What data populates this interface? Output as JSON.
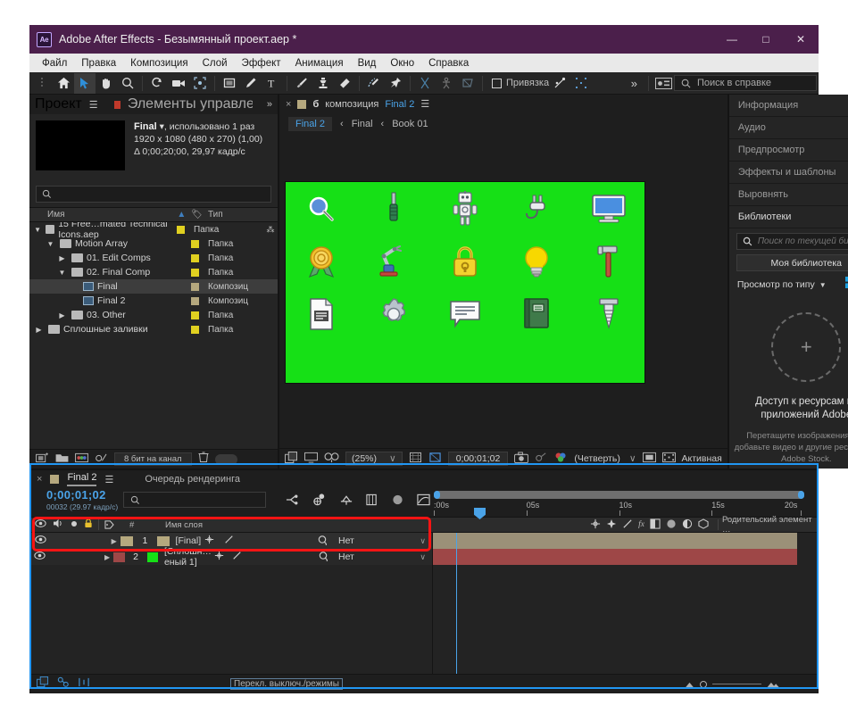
{
  "window": {
    "title": "Adobe After Effects - Безымянный проект.aep *",
    "logo_text": "Ae",
    "minimize": "—",
    "maximize": "□",
    "close": "✕"
  },
  "menu": {
    "items": [
      "Файл",
      "Правка",
      "Композиция",
      "Слой",
      "Эффект",
      "Анимация",
      "Вид",
      "Окно",
      "Справка"
    ]
  },
  "toolbar": {
    "snap_label": "Привязка",
    "overflow": "»",
    "help_placeholder": "Поиск в справке"
  },
  "project_panel": {
    "tab_active": "Проект",
    "tab_secondary": "Элементы управления эффект",
    "overflow": "»",
    "item_name": "Final",
    "usage": ", использовано 1 раз",
    "dimensions": "1920 x 1080  (480 x 270) (1,00)",
    "duration": "Δ 0;00;20;00, 29,97 кадр/с",
    "search_placeholder": "",
    "col_name": "Имя",
    "col_type": "Тип",
    "bit_depth": "8 бит на канал",
    "tree": [
      {
        "label": "15 Free…mated Technical Icons.aep",
        "type": "Папка",
        "depth": 0,
        "arrow": "v",
        "icon": "folder",
        "swatch": "#e0d020",
        "selected": false
      },
      {
        "label": "Motion Array",
        "type": "Папка",
        "depth": 1,
        "arrow": "v",
        "icon": "folder",
        "swatch": "#e0d020",
        "selected": false
      },
      {
        "label": "01. Edit Comps",
        "type": "Папка",
        "depth": 2,
        "arrow": ">",
        "icon": "folder",
        "swatch": "#e0d020",
        "selected": false
      },
      {
        "label": "02. Final Comp",
        "type": "Папка",
        "depth": 2,
        "arrow": "v",
        "icon": "folder",
        "swatch": "#e0d020",
        "selected": false
      },
      {
        "label": "Final",
        "type": "Композиц",
        "depth": 3,
        "arrow": "",
        "icon": "comp",
        "swatch": "#b5a87e",
        "selected": true
      },
      {
        "label": "Final 2",
        "type": "Композиц",
        "depth": 3,
        "arrow": "",
        "icon": "comp",
        "swatch": "#b5a87e",
        "selected": false
      },
      {
        "label": "03. Other",
        "type": "Папка",
        "depth": 2,
        "arrow": ">",
        "icon": "folder",
        "swatch": "#e0d020",
        "selected": false
      },
      {
        "label": "Сплошные заливки",
        "type": "Папка",
        "depth": 0,
        "arrow": ">",
        "icon": "folder",
        "swatch": "#e0d020",
        "selected": false
      }
    ]
  },
  "comp_panel": {
    "close_x": "×",
    "lock_glyph": "б",
    "tab_prefix": "композиция",
    "tab_name": "Final 2",
    "breadcrumbs": [
      {
        "label": "Final 2",
        "active": true
      },
      {
        "label": "Final",
        "active": false
      },
      {
        "label": "Book 01",
        "active": false
      }
    ],
    "crumb_sep": "‹",
    "footer": {
      "zoom": "(25%)",
      "timecode": "0;00;01;02",
      "quality": "(Четверть)",
      "view": "Активная",
      "caret": "∨"
    },
    "stage_bg": "#16e016",
    "icons": [
      "magnifier-icon",
      "screwdriver-icon",
      "robot-icon",
      "plug-icon",
      "monitor-icon",
      "award-ribbon-icon",
      "robot-arm-icon",
      "padlock-icon",
      "lightbulb-icon",
      "hammer-icon",
      "document-icon",
      "gear-icon",
      "speech-bubble-icon",
      "book-icon",
      "screw-bolt-icon"
    ]
  },
  "right_panel": {
    "rows": [
      "Информация",
      "Аудио",
      "Предпросмотр",
      "Эффекты и шаблоны",
      "Выровнять"
    ],
    "active_row": "Библиотеки",
    "search_placeholder": "Поиск по текущей библиот",
    "library_select": "Моя библиотека",
    "view_by_type": "Просмотр по типу",
    "dropzone_plus": "+",
    "dropzone_title": "Доступ к ресурсам из приложений Adobe",
    "dropzone_sub": "Перетащите изображения или добавьте видео и другие ресурсы из Adobe Stock.",
    "caret": "▼",
    "accent": "#1ba0e1"
  },
  "timeline": {
    "tab_name": "Final 2",
    "tab_secondary": "Очередь рендеринга",
    "close_x": "×",
    "timecode": "0;00;01;02",
    "frames": "00032 (29.97 кадр/с)",
    "search_placeholder": "",
    "headers": {
      "layer_name": "Имя слоя",
      "num": "#",
      "fx": "fx",
      "parent": "Родительский элемент …"
    },
    "ruler_ticks": [
      {
        "label": ":00s",
        "pos": 0
      },
      {
        "label": "05s",
        "pos": 25
      },
      {
        "label": "10s",
        "pos": 50
      },
      {
        "label": "15s",
        "pos": 75
      },
      {
        "label": "20s",
        "pos": 99
      }
    ],
    "layers": [
      {
        "num": "1",
        "name": "[Final]",
        "parent": "Нет",
        "swatch": "#b5a87e",
        "fill": "#b5a87e",
        "arrow": ">"
      },
      {
        "num": "2",
        "name": "[Сплошн…еный 1]",
        "parent": "Нет",
        "swatch": "#9e4747",
        "fill": "#16e016",
        "arrow": ">"
      }
    ],
    "footer_label": "Перекл. выключ./режимы"
  }
}
